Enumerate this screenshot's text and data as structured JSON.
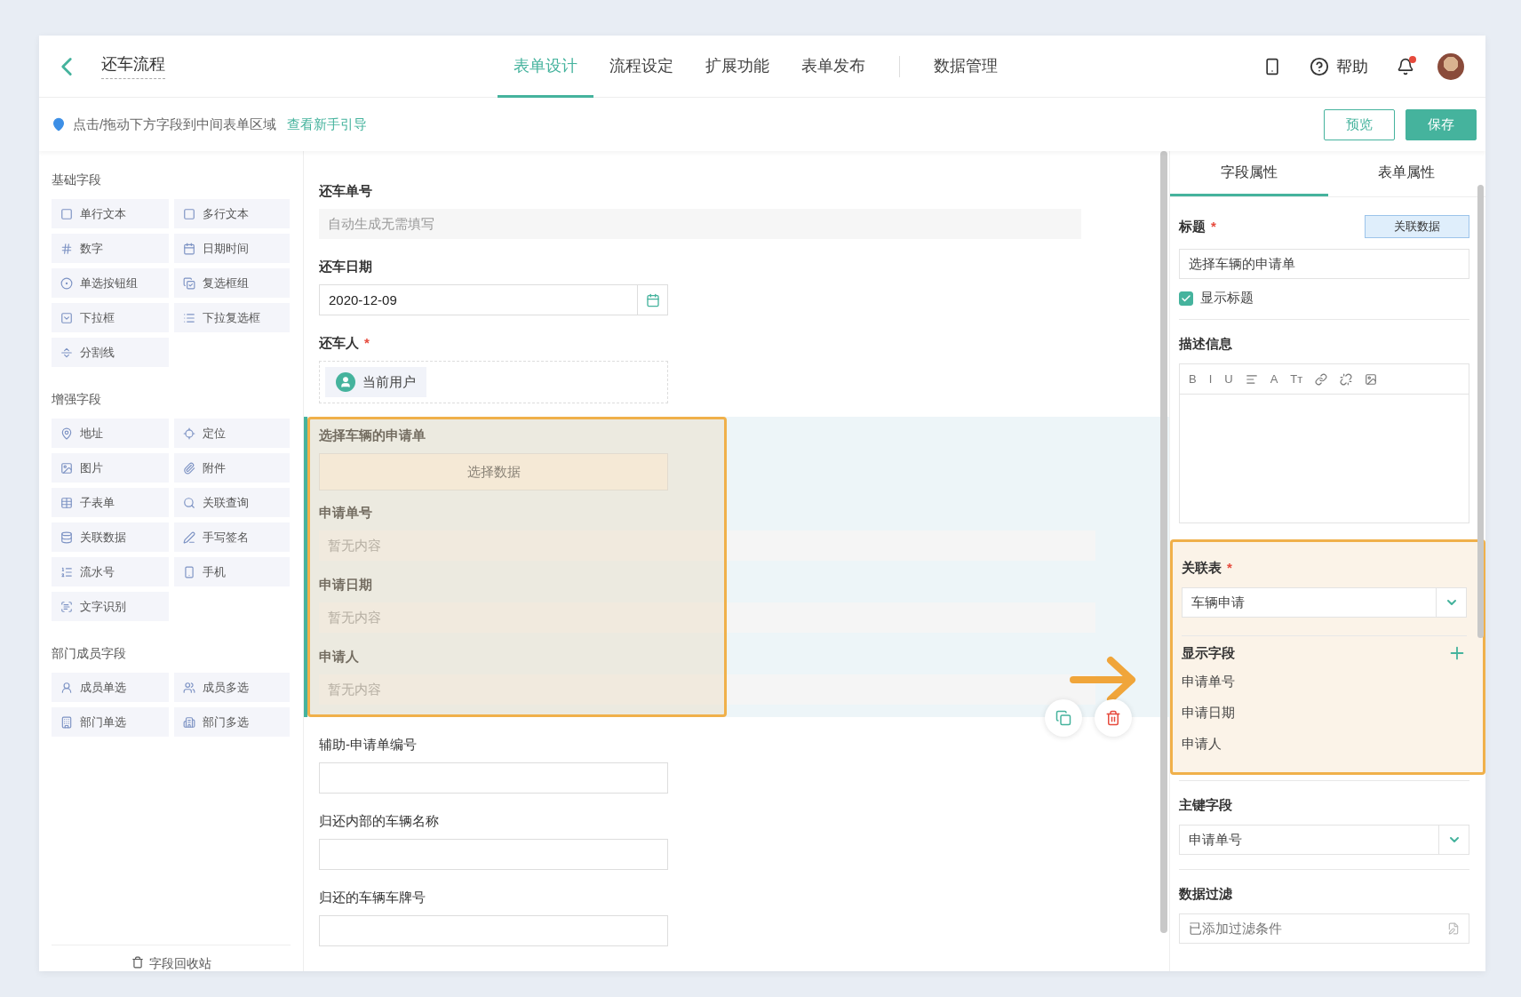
{
  "header": {
    "title": "还车流程",
    "tabs": [
      {
        "label": "表单设计",
        "selected": true
      },
      {
        "label": "流程设定",
        "selected": false
      },
      {
        "label": "扩展功能",
        "selected": false
      },
      {
        "label": "表单发布",
        "selected": false
      },
      {
        "label": "数据管理",
        "selected": false
      }
    ],
    "help_label": "帮助",
    "notification": true
  },
  "hint": {
    "text": "点击/拖动下方字段到中间表单区域",
    "link": "查看新手引导"
  },
  "actions": [
    {
      "label": "预览",
      "kind": "outline"
    },
    {
      "label": "保存",
      "kind": "primary"
    }
  ],
  "palette": {
    "groups": [
      {
        "title": "基础字段",
        "items": [
          "单行文本",
          "多行文本",
          "数字",
          "日期时间",
          "单选按钮组",
          "复选框组",
          "下拉框",
          "下拉复选框",
          "分割线"
        ]
      },
      {
        "title": "增强字段",
        "items": [
          "地址",
          "定位",
          "图片",
          "附件",
          "子表单",
          "关联查询",
          "关联数据",
          "手写签名",
          "流水号",
          "手机",
          "文字识别"
        ]
      },
      {
        "title": "部门成员字段",
        "items": [
          "成员单选",
          "成员多选",
          "部门单选",
          "部门多选"
        ]
      }
    ],
    "footer": "字段回收站"
  },
  "form": [
    {
      "kind": "readonly",
      "label": "还车单号",
      "placeholder": "自动生成无需填写"
    },
    {
      "kind": "date",
      "label": "还车日期",
      "value": "2020-12-09"
    },
    {
      "kind": "user",
      "label": "还车人",
      "required_mark": "*",
      "value": "当前用户"
    },
    {
      "kind": "linked",
      "label": "选择车辆的申请单",
      "button": "选择数据",
      "selected": true,
      "highlighted": true,
      "fields": [
        {
          "label": "申请单号",
          "placeholder": "暂无内容"
        },
        {
          "label": "申请日期",
          "placeholder": "暂无内容"
        },
        {
          "label": "申请人",
          "placeholder": "暂无内容"
        }
      ]
    },
    {
      "kind": "text",
      "label": "辅助-申请单编号"
    },
    {
      "kind": "text",
      "label": "归还内部的车辆名称"
    },
    {
      "kind": "text",
      "label": "归还的车辆车牌号"
    }
  ],
  "properties": {
    "tabs": [
      {
        "label": "字段属性",
        "selected": true
      },
      {
        "label": "表单属性",
        "selected": false
      }
    ],
    "title_field": {
      "label": "标题",
      "required_mark": "*",
      "button": "关联数据",
      "value": "选择车辆的申请单"
    },
    "show_title": {
      "label": "显示标题",
      "checked": true
    },
    "description": {
      "label": "描述信息",
      "tools": [
        {
          "kind": "text",
          "label": "B"
        },
        {
          "kind": "text",
          "label": "I"
        },
        {
          "kind": "text",
          "label": "U"
        },
        {
          "kind": "align"
        },
        {
          "kind": "text",
          "label": "A"
        },
        {
          "kind": "text",
          "label": "Tт"
        },
        {
          "kind": "link"
        },
        {
          "kind": "unlink"
        },
        {
          "kind": "image"
        }
      ]
    },
    "linked_table": {
      "label": "关联表",
      "required_mark": "*",
      "value": "车辆申请",
      "highlighted": true
    },
    "display_fields": {
      "label": "显示字段",
      "items": [
        "申请单号",
        "申请日期",
        "申请人"
      ]
    },
    "primary_key": {
      "label": "主键字段",
      "value": "申请单号"
    },
    "data_filter": {
      "label": "数据过滤",
      "placeholder": "已添加过滤条件"
    }
  }
}
